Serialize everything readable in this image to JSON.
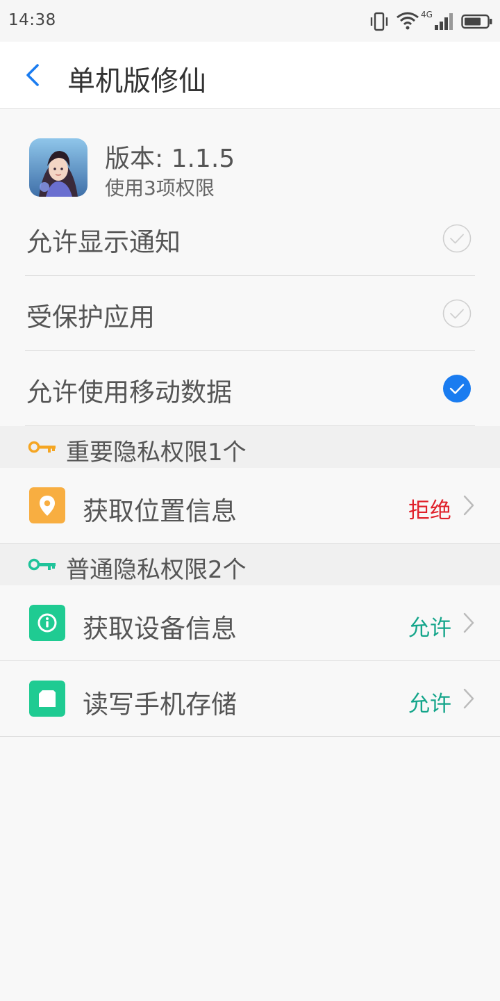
{
  "status_bar": {
    "time": "14:38",
    "network_label": "4G",
    "icons": [
      "vibrate-icon",
      "wifi-icon",
      "cellular-signal-icon",
      "battery-icon"
    ]
  },
  "app_bar": {
    "title": "单机版修仙",
    "back_icon": "chevron-left-icon"
  },
  "app_info": {
    "version": "版本: 1.1.5",
    "permission_count": "使用3项权限"
  },
  "toggles": [
    {
      "label": "允许显示通知",
      "checked": false
    },
    {
      "label": "受保护应用",
      "checked": false
    },
    {
      "label": "允许使用移动数据",
      "checked": true
    }
  ],
  "sections": [
    {
      "title": "重要隐私权限1个",
      "key_color": "#f5a623",
      "items": [
        {
          "label": "获取位置信息",
          "status": "拒绝",
          "status_color": "#e0202a",
          "icon": "location-pin-icon",
          "icon_bg": "#f8ae41"
        }
      ]
    },
    {
      "title": "普通隐私权限2个",
      "key_color": "#1fc39a",
      "items": [
        {
          "label": "获取设备信息",
          "status": "允许",
          "status_color": "#14a58a",
          "icon": "info-icon",
          "icon_bg": "#1fcb92"
        },
        {
          "label": "读写手机存储",
          "status": "允许",
          "status_color": "#14a58a",
          "icon": "storage-card-icon",
          "icon_bg": "#1fcb92"
        }
      ]
    }
  ],
  "colors": {
    "accent": "#1a7cf0",
    "chevron": "#bbbbbb",
    "divider": "#dddddd"
  }
}
